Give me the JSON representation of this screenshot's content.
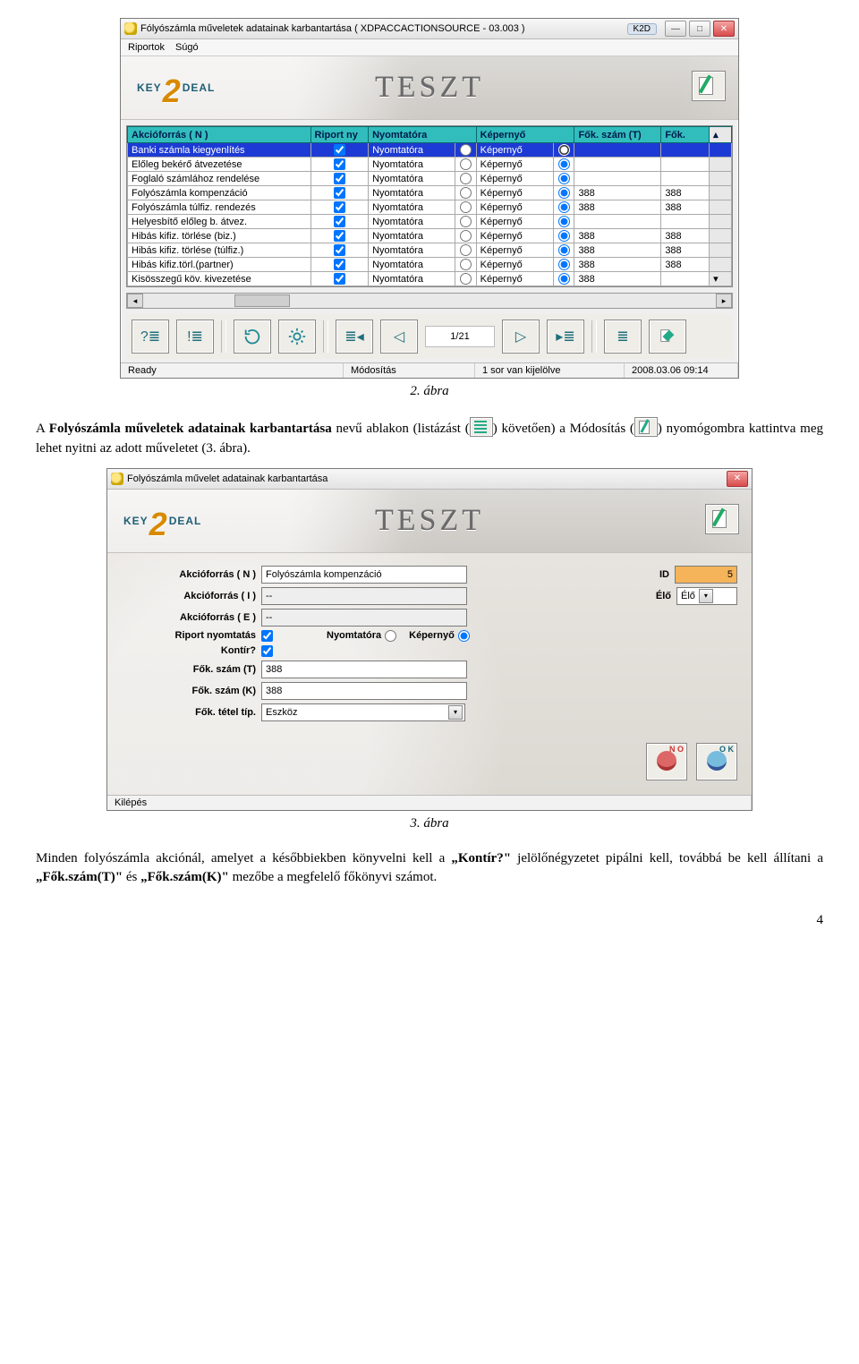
{
  "page_number": "4",
  "caption1": "2. ábra",
  "caption2": "3. ábra",
  "para1_a": "A ",
  "para1_b": "Folyószámla műveletek adatainak karbantartása",
  "para1_c": " nevű ablakon (listázást (",
  "para1_d": ") követően) a Módosítás (",
  "para1_e": ") nyomógombra kattintva meg lehet nyitni az adott műveletet (3. ábra).",
  "para2_a": "Minden folyószámla akciónál, amelyet a későbbiekben könyvelni kell a ",
  "para2_b": "„Kontír?\"",
  "para2_c": " jelölőnégyzetet pipálni kell, továbbá be kell állítani a ",
  "para2_d": "„Fők.szám(T)\"",
  "para2_e": " és ",
  "para2_f": "„Fők.szám(K)\"",
  "para2_g": " mezőbe a megfelelő főkönyvi számot.",
  "win1": {
    "title": "Fólyószámla műveletek adatainak karbantartása ( XDPACCACTIONSOURCE - 03.003 )",
    "k2d": "K2D",
    "menu": [
      "Riportok",
      "Súgó"
    ],
    "logo_key": "KEY",
    "logo_deal": "DEAL",
    "teszt": "TESZT",
    "headers": [
      "Akcióforrás ( N )",
      "Riport ny",
      "Nyomtatóra",
      "Képernyő",
      "Fők. szám (T)",
      "Fők."
    ],
    "col_printer": "Nyomtatóra",
    "col_screen": "Képernyő",
    "rows": [
      {
        "name": "Banki számla kiegyenlítés",
        "chk": true,
        "sel": "screen",
        "t": "",
        "k": ""
      },
      {
        "name": "Előleg bekérő átvezetése",
        "chk": true,
        "sel": "screen",
        "t": "",
        "k": ""
      },
      {
        "name": "Foglaló számlához rendelése",
        "chk": true,
        "sel": "screen",
        "t": "",
        "k": ""
      },
      {
        "name": "Folyószámla kompenzáció",
        "chk": true,
        "sel": "screen",
        "t": "388",
        "k": "388"
      },
      {
        "name": "Folyószámla túlfiz. rendezés",
        "chk": true,
        "sel": "screen",
        "t": "388",
        "k": "388"
      },
      {
        "name": "Helyesbítő előleg b. átvez.",
        "chk": true,
        "sel": "screen",
        "t": "",
        "k": ""
      },
      {
        "name": "Hibás kifiz. törlése (biz.)",
        "chk": true,
        "sel": "screen",
        "t": "388",
        "k": "388"
      },
      {
        "name": "Hibás kifiz. törlése (túlfiz.)",
        "chk": true,
        "sel": "screen",
        "t": "388",
        "k": "388"
      },
      {
        "name": "Hibás kifiz.törl.(partner)",
        "chk": true,
        "sel": "screen",
        "t": "388",
        "k": "388"
      },
      {
        "name": "Kisösszegű köv. kivezetése",
        "chk": true,
        "sel": "screen",
        "t": "388",
        "k": ""
      }
    ],
    "pager": "1/21",
    "status": {
      "ready": "Ready",
      "mode": "Módosítás",
      "sel": "1 sor van kijelölve",
      "ts": "2008.03.06 09:14"
    }
  },
  "win2": {
    "title": "Folyószámla művelet adatainak karbantartása",
    "teszt": "TESZT",
    "logo_key": "KEY",
    "logo_deal": "DEAL",
    "labels": {
      "akcN": "Akcióforrás ( N )",
      "akcI": "Akcióforrás ( I )",
      "akcE": "Akcióforrás ( E )",
      "riport": "Riport nyomtatás",
      "printer": "Nyomtatóra",
      "screen": "Képernyő",
      "kontir": "Kontír?",
      "fokT": "Fők. szám (T)",
      "fokK": "Fők. szám (K)",
      "tetel": "Fők. tétel típ.",
      "id": "ID",
      "elo": "Élő"
    },
    "values": {
      "akcN": "Folyószámla kompenzáció",
      "akcI": "--",
      "akcE": "--",
      "id": "5",
      "elo": "Élő",
      "fokT": "388",
      "fokK": "388",
      "tetel": "Eszköz"
    },
    "btn_no": "N O",
    "btn_ok": "O K",
    "status": "Kilépés"
  }
}
